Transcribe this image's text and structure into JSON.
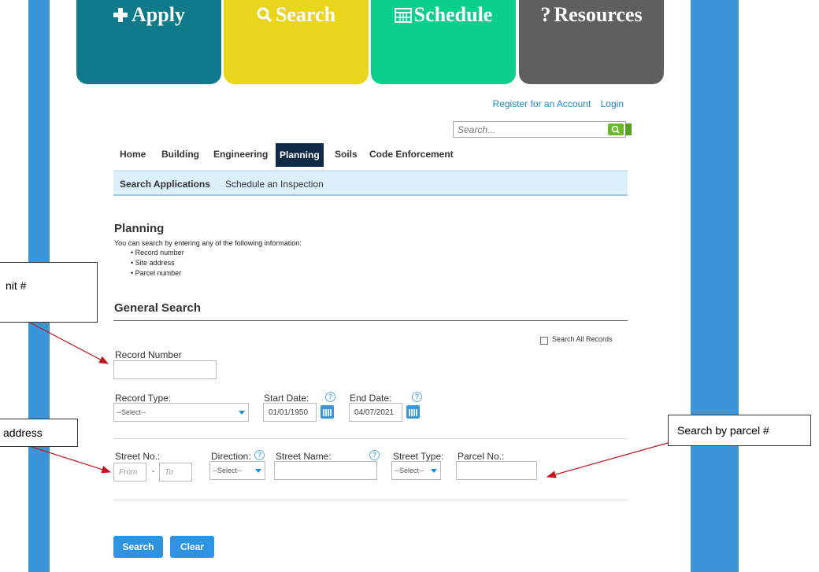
{
  "tiles": [
    {
      "label": "Apply",
      "icon": "plus-icon"
    },
    {
      "label": "Search",
      "icon": "magnifier-icon"
    },
    {
      "label": "Schedule",
      "icon": "calendar-icon"
    },
    {
      "label": "Resources",
      "icon": "question-icon"
    }
  ],
  "account": {
    "register": "Register for an Account",
    "login": "Login"
  },
  "global_search": {
    "placeholder": "Search..."
  },
  "nav": {
    "items": [
      "Home",
      "Building",
      "Engineering",
      "Planning",
      "Soils",
      "Code Enforcement"
    ],
    "active": "Planning"
  },
  "subnav": {
    "items": [
      "Search Applications",
      "Schedule an Inspection"
    ],
    "active": "Search Applications"
  },
  "page": {
    "title": "Planning",
    "intro": "You can search by entering any of the following information:",
    "bullets": [
      "Record number",
      "Site address",
      "Parcel number"
    ]
  },
  "general_search": {
    "heading": "General Search",
    "search_all_label": "Search All Records",
    "record_number_label": "Record Number",
    "record_type_label": "Record Type:",
    "record_type_value": "--Select--",
    "start_date_label": "Start Date:",
    "start_date_value": "01/01/1950",
    "end_date_label": "End Date:",
    "end_date_value": "04/07/2021",
    "street_no_label": "Street No.:",
    "from_placeholder": "From",
    "to_placeholder": "To",
    "dash": "-",
    "direction_label": "Direction:",
    "direction_value": "--Select--",
    "street_name_label": "Street Name:",
    "street_type_label": "Street Type:",
    "street_type_value": "--Select--",
    "parcel_no_label": "Parcel No.:",
    "search_button": "Search",
    "clear_button": "Clear"
  },
  "annotations": {
    "callout_permit": "nit #",
    "callout_address": "address",
    "callout_parcel": "Search by parcel #",
    "arrow_color": "#c0161d"
  },
  "colors": {
    "side_bar": "#3a96d9",
    "apply": "#0f7a8c",
    "search": "#e8d51c",
    "schedule": "#0ccf8d",
    "resources": "#5f5f5f",
    "nav_active": "#0e2a47"
  }
}
